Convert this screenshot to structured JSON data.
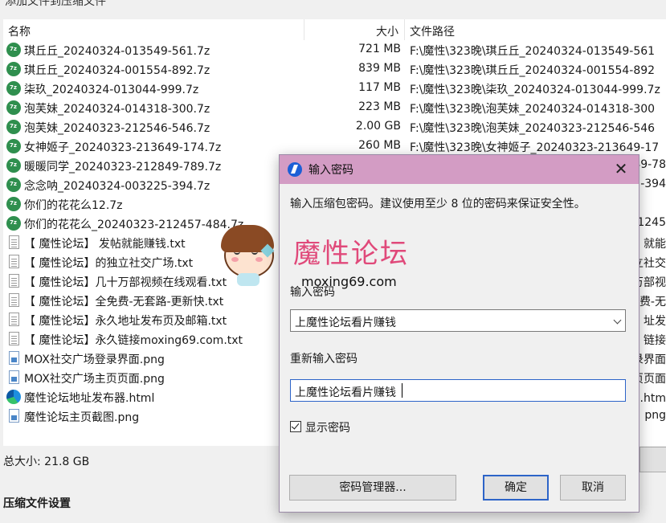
{
  "window": {
    "top_title": "添加文件到压缩文件"
  },
  "list": {
    "headers": {
      "name": "名称",
      "size": "大小",
      "path": "文件路径"
    },
    "rows": [
      {
        "icon": "7z-archive-icon",
        "name": "琪丘丘_20240324-013549-561.7z",
        "size": "721 MB",
        "path": "F:\\魔性\\323晚\\琪丘丘_20240324-013549-561"
      },
      {
        "icon": "7z-archive-icon",
        "name": "琪丘丘_20240324-001554-892.7z",
        "size": "839 MB",
        "path": "F:\\魔性\\323晚\\琪丘丘_20240324-001554-892"
      },
      {
        "icon": "7z-archive-icon",
        "name": "柒玖_20240324-013044-999.7z",
        "size": "117 MB",
        "path": "F:\\魔性\\323晚\\柒玖_20240324-013044-999.7z"
      },
      {
        "icon": "7z-archive-icon",
        "name": "泡芙妹_20240324-014318-300.7z",
        "size": "223 MB",
        "path": "F:\\魔性\\323晚\\泡芙妹_20240324-014318-300"
      },
      {
        "icon": "7z-archive-icon",
        "name": "泡芙妹_20240323-212546-546.7z",
        "size": "2.00 GB",
        "path": "F:\\魔性\\323晚\\泡芙妹_20240323-212546-546"
      },
      {
        "icon": "7z-archive-icon",
        "name": "女神姬子_20240323-213649-174.7z",
        "size": "260 MB",
        "path": "F:\\魔性\\323晚\\女神姬子_20240323-213649-17"
      },
      {
        "icon": "7z-archive-icon",
        "name": "暖暖同学_20240323-212849-789.7z",
        "size": "",
        "path": "49-78"
      },
      {
        "icon": "7z-archive-icon",
        "name": "念念呐_20240324-003225-394.7z",
        "size": "",
        "path": "-394"
      },
      {
        "icon": "7z-archive-icon",
        "name": "你们的花花么12.7z",
        "size": "",
        "path": ""
      },
      {
        "icon": "7z-archive-icon",
        "name": "你们的花花么_20240323-212457-484.7z",
        "size": "",
        "path": "1245"
      },
      {
        "icon": "text-file-icon",
        "name": "【 魔性论坛】 发帖就能赚钱.txt",
        "size": "",
        "path": "就能"
      },
      {
        "icon": "text-file-icon",
        "name": "【 魔性论坛】的独立社交广场.txt",
        "size": "",
        "path": "立社交"
      },
      {
        "icon": "text-file-icon",
        "name": "【 魔性论坛】几十万部视频在线观看.txt",
        "size": "",
        "path": "万部视"
      },
      {
        "icon": "text-file-icon",
        "name": "【 魔性论坛】全免费-无套路-更新快.txt",
        "size": "",
        "path": "费-无"
      },
      {
        "icon": "text-file-icon",
        "name": "【 魔性论坛】永久地址发布页及邮箱.txt",
        "size": "",
        "path": "址发"
      },
      {
        "icon": "text-file-icon",
        "name": "【 魔性论坛】永久链接moxing69.com.txt",
        "size": "",
        "path": "链接"
      },
      {
        "icon": "png-image-icon",
        "name": "MOX社交广场登录界面.png",
        "size": "",
        "path": "录界面"
      },
      {
        "icon": "png-image-icon",
        "name": "MOX社交广场主页页面.png",
        "size": "",
        "path": "页页面"
      },
      {
        "icon": "html-file-icon",
        "name": "魔性论坛地址发布器.html",
        "size": "",
        "path": "器.htm"
      },
      {
        "icon": "png-image-icon",
        "name": "魔性论坛主页截图.png",
        "size": "",
        "path": "png"
      }
    ]
  },
  "total_size": "总大小: 21.8 GB",
  "settings_title": "压缩文件设置",
  "dialog": {
    "title": "输入密码",
    "instruction": "输入压缩包密码。建议使用至少 8 位的密码来保证安全性。",
    "password_label": "输入密码",
    "password_value": "上魔性论坛看片赚钱",
    "reenter_label": "重新输入密码",
    "reenter_value": "上魔性论坛看片赚钱",
    "show_password_label": "显示密码",
    "show_password_checked": true,
    "manager_button": "密码管理器...",
    "ok_button": "确定",
    "cancel_button": "取消",
    "accent_color": "#d39cc4"
  },
  "watermark": {
    "text": "魔性论坛",
    "url": "moxing69.com",
    "color": "#e0497a"
  }
}
